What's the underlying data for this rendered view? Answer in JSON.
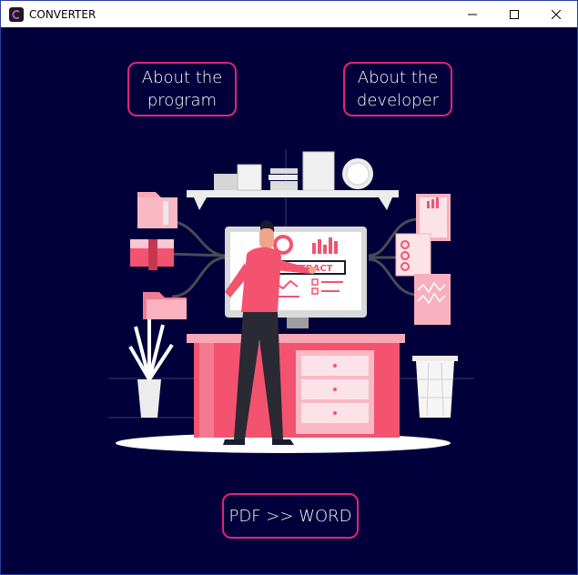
{
  "window": {
    "title": "CONVERTER",
    "controls": [
      "minimize",
      "maximize",
      "close"
    ]
  },
  "buttons": {
    "about_program": [
      "About the",
      "program"
    ],
    "about_developer": [
      "About the",
      "developer"
    ],
    "convert": "PDF >> WORD"
  },
  "illustration": {
    "screen_label": "EXTRACT"
  },
  "colors": {
    "background": "#01003a",
    "accent": "#e0247a",
    "illustration_pink": "#f4536f"
  }
}
